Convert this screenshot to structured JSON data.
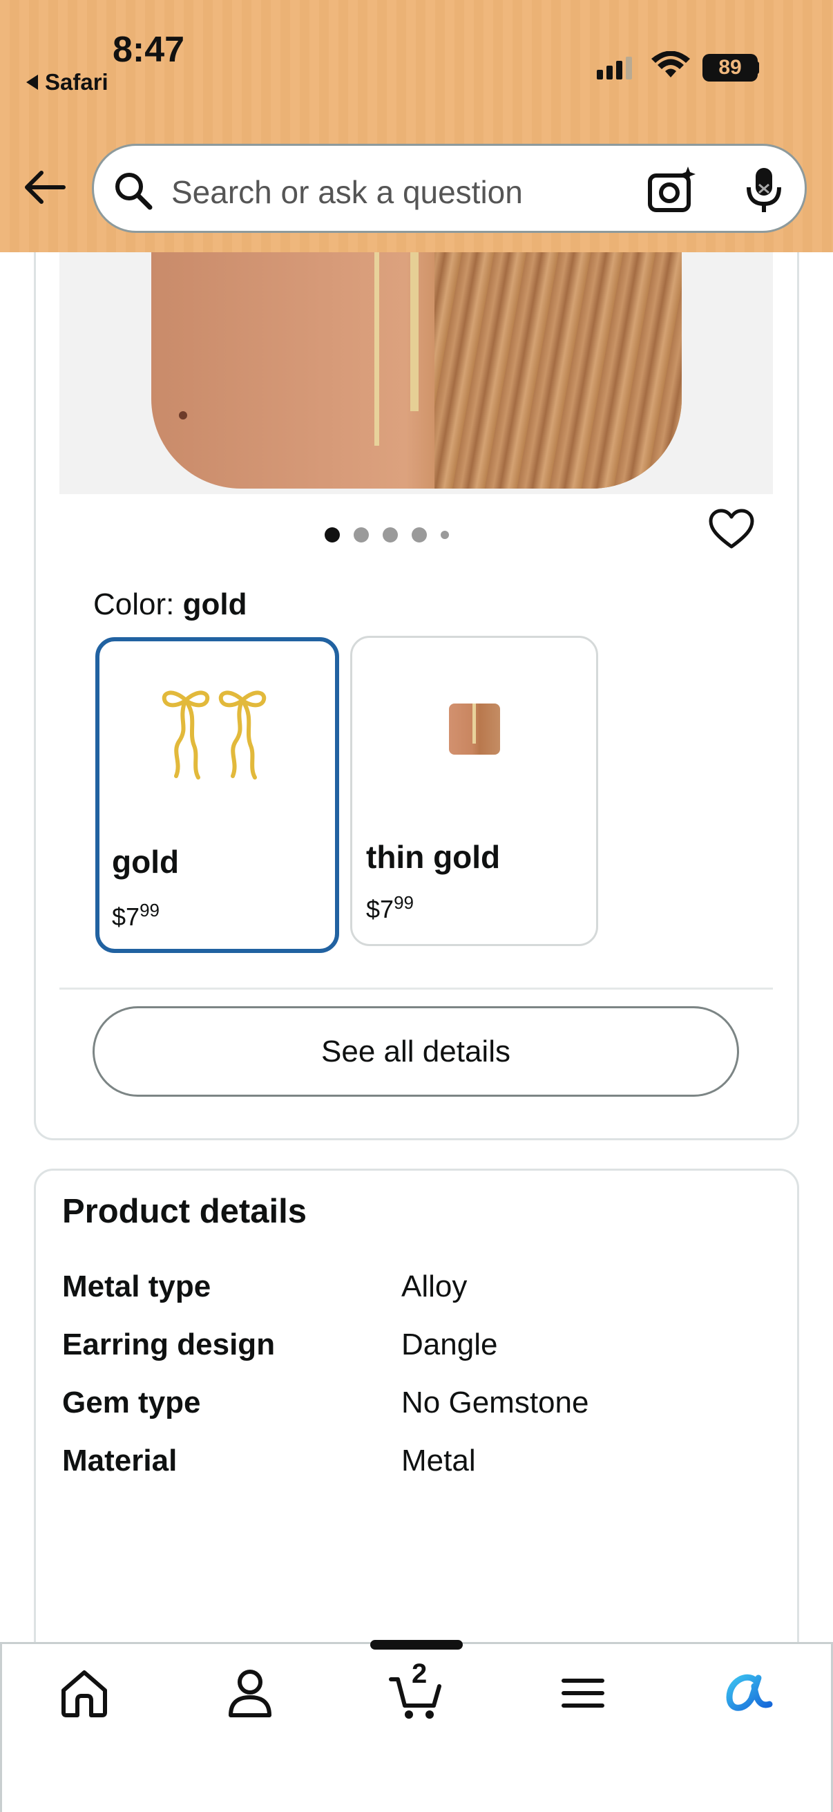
{
  "status_bar": {
    "time": "8:47",
    "back_app": "Safari",
    "battery": "89"
  },
  "search": {
    "placeholder": "Search or ask a question"
  },
  "product": {
    "color_label": "Color:",
    "selected_color": "gold",
    "image_dots": 5,
    "variants": [
      {
        "name": "gold",
        "price_symbol": "$",
        "price_whole": "7",
        "price_fraction": "99",
        "selected": true
      },
      {
        "name": "thin gold",
        "price_symbol": "$",
        "price_whole": "7",
        "price_fraction": "99",
        "selected": false
      }
    ],
    "see_all_label": "See all details"
  },
  "details": {
    "title": "Product details",
    "rows": [
      {
        "key": "Metal type",
        "value": "Alloy"
      },
      {
        "key": "Earring design",
        "value": "Dangle"
      },
      {
        "key": "Gem type",
        "value": "No Gemstone"
      },
      {
        "key": "Material",
        "value": "Metal"
      }
    ]
  },
  "tabbar": {
    "cart_count": "2",
    "tabs": [
      "home-icon",
      "account-icon",
      "cart-icon",
      "menu-icon",
      "rufus-icon"
    ]
  },
  "colors": {
    "accent": "#2162a1",
    "header": "#efb77c",
    "rufus": "#1a8ee8"
  }
}
